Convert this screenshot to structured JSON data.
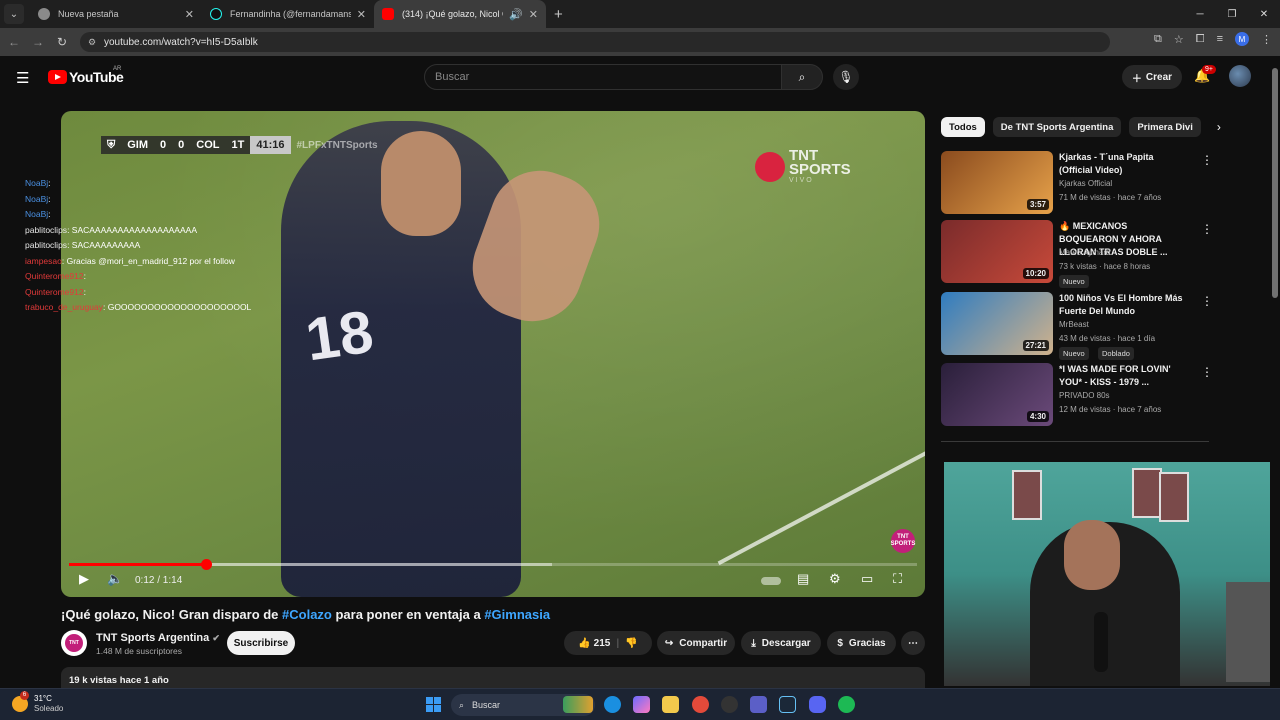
{
  "browser": {
    "tabs": [
      {
        "title": "Nueva pestaña",
        "color": "#8a8a8a"
      },
      {
        "title": "Fernandinha (@fernandamansk",
        "color": "#111111"
      },
      {
        "title": "(314) ¡Qué golazo, Nicol Gr",
        "color": "#ff0000"
      }
    ],
    "url": "youtube.com/watch?v=hI5-D5aIblk",
    "profile_initial": "M"
  },
  "youtube": {
    "logo_text": "YouTube",
    "country_code": "AR",
    "search_placeholder": "Buscar",
    "create_label": "Crear",
    "notif_badge": "9+"
  },
  "video": {
    "scorebug": {
      "home": "GIM",
      "home_score": "0",
      "away_score": "0",
      "away": "COL",
      "period": "1T",
      "clock": "41:16",
      "hashtag": "#LPFxTNTSports"
    },
    "broadcaster": {
      "name": "TNT",
      "line2": "SPORTS",
      "line3": "VIVO"
    },
    "jersey_number": "18",
    "time_display": "0:12 / 1:14",
    "progress": 0.162,
    "buffered": 0.57,
    "title_prefix": "¡Qué golazo, Nico! Gran disparo de ",
    "title_hash1": "#Colazo",
    "title_mid": " para poner en ventaja a ",
    "title_hash2": "#Gimnasia",
    "views_line": "19 k vistas  hace 1 año"
  },
  "channel": {
    "name": "TNT Sports Argentina",
    "subscribers": "1.48 M de suscriptores",
    "subscribe_label": "Suscribirse",
    "avatar_text": "TNT"
  },
  "actions": {
    "likes": "215",
    "share": "Compartir",
    "download": "Descargar",
    "thanks": "Gracias"
  },
  "chat": [
    {
      "user": "NoaBj",
      "msg": ": ",
      "cls": "user-a"
    },
    {
      "user": "NoaBj",
      "msg": ": ",
      "cls": "user-a"
    },
    {
      "user": "NoaBj",
      "msg": ": ",
      "cls": "user-a"
    },
    {
      "user": "pablitoclips",
      "msg": ": SACAAAAAAAAAAAAAAAAAAA",
      "cls": "user-b"
    },
    {
      "user": "pablitoclips",
      "msg": ": SACAAAAAAAAA",
      "cls": "user-b"
    },
    {
      "user": "iampesao",
      "msg": ": Gracias @mori_en_madrid_912 por el follow",
      "cls": "user-c"
    },
    {
      "user": "Quinterome912",
      "msg": ": ",
      "cls": "user-c"
    },
    {
      "user": "Quinterome912",
      "msg": ": ",
      "cls": "user-c"
    },
    {
      "user": "trabuco_de_uruguay",
      "msg": ": GOOOOOOOOOOOOOOOOOOOOL",
      "cls": "user-c"
    }
  ],
  "chips": [
    "Todos",
    "De TNT Sports Argentina",
    "Primera Divi"
  ],
  "recommendations": [
    {
      "title": "Kjarkas - T´una Papita (Official Video)",
      "channel": "Kjarkas Official",
      "meta": "71 M de vistas · hace 7 años",
      "duration": "3:57",
      "tags": [],
      "colors": [
        "#8a4b1e",
        "#e7a24a"
      ]
    },
    {
      "title": "🔥 MEXICANOS BOQUEARON Y AHORA LLORAN TRAS DOBLE ...",
      "channel": "Mateo Aymard",
      "meta": "73 k vistas · hace 8 horas",
      "duration": "10:20",
      "tags": [
        "Nuevo"
      ],
      "colors": [
        "#7a2b2b",
        "#c84a3a"
      ]
    },
    {
      "title": "100 Niños Vs El Hombre Más Fuerte Del Mundo",
      "channel": "MrBeast",
      "meta": "43 M de vistas · hace 1 día",
      "duration": "27:21",
      "tags": [
        "Nuevo",
        "Doblado"
      ],
      "colors": [
        "#2f7cc0",
        "#d0b28c"
      ]
    },
    {
      "title": "*I WAS MADE FOR LOVIN' YOU* - KISS - 1979 ...",
      "channel": "PRIVADO 80s",
      "meta": "12 M de vistas · hace 7 años",
      "duration": "4:30",
      "tags": [],
      "colors": [
        "#2a1f3a",
        "#6b4a7a"
      ]
    }
  ],
  "taskbar": {
    "temperature": "31°C",
    "weather": "Soleado",
    "weather_badge": "6",
    "search_label": "Buscar"
  }
}
